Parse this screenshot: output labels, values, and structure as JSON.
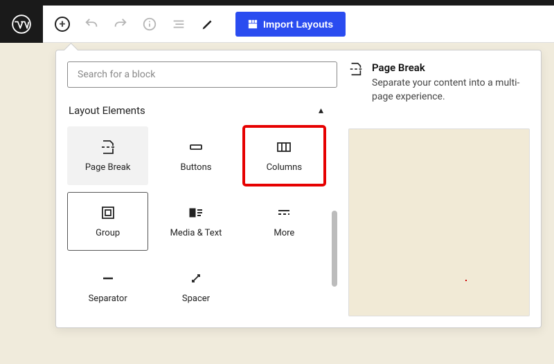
{
  "toolbar": {
    "import_label": "Import Layouts"
  },
  "inserter": {
    "search_placeholder": "Search for a block",
    "section_title": "Layout Elements",
    "blocks": {
      "page_break": "Page Break",
      "buttons": "Buttons",
      "columns": "Columns",
      "group": "Group",
      "media_text": "Media & Text",
      "more": "More",
      "separator": "Separator",
      "spacer": "Spacer"
    }
  },
  "info": {
    "title": "Page Break",
    "description": "Separate your content into a multi-page experience."
  }
}
